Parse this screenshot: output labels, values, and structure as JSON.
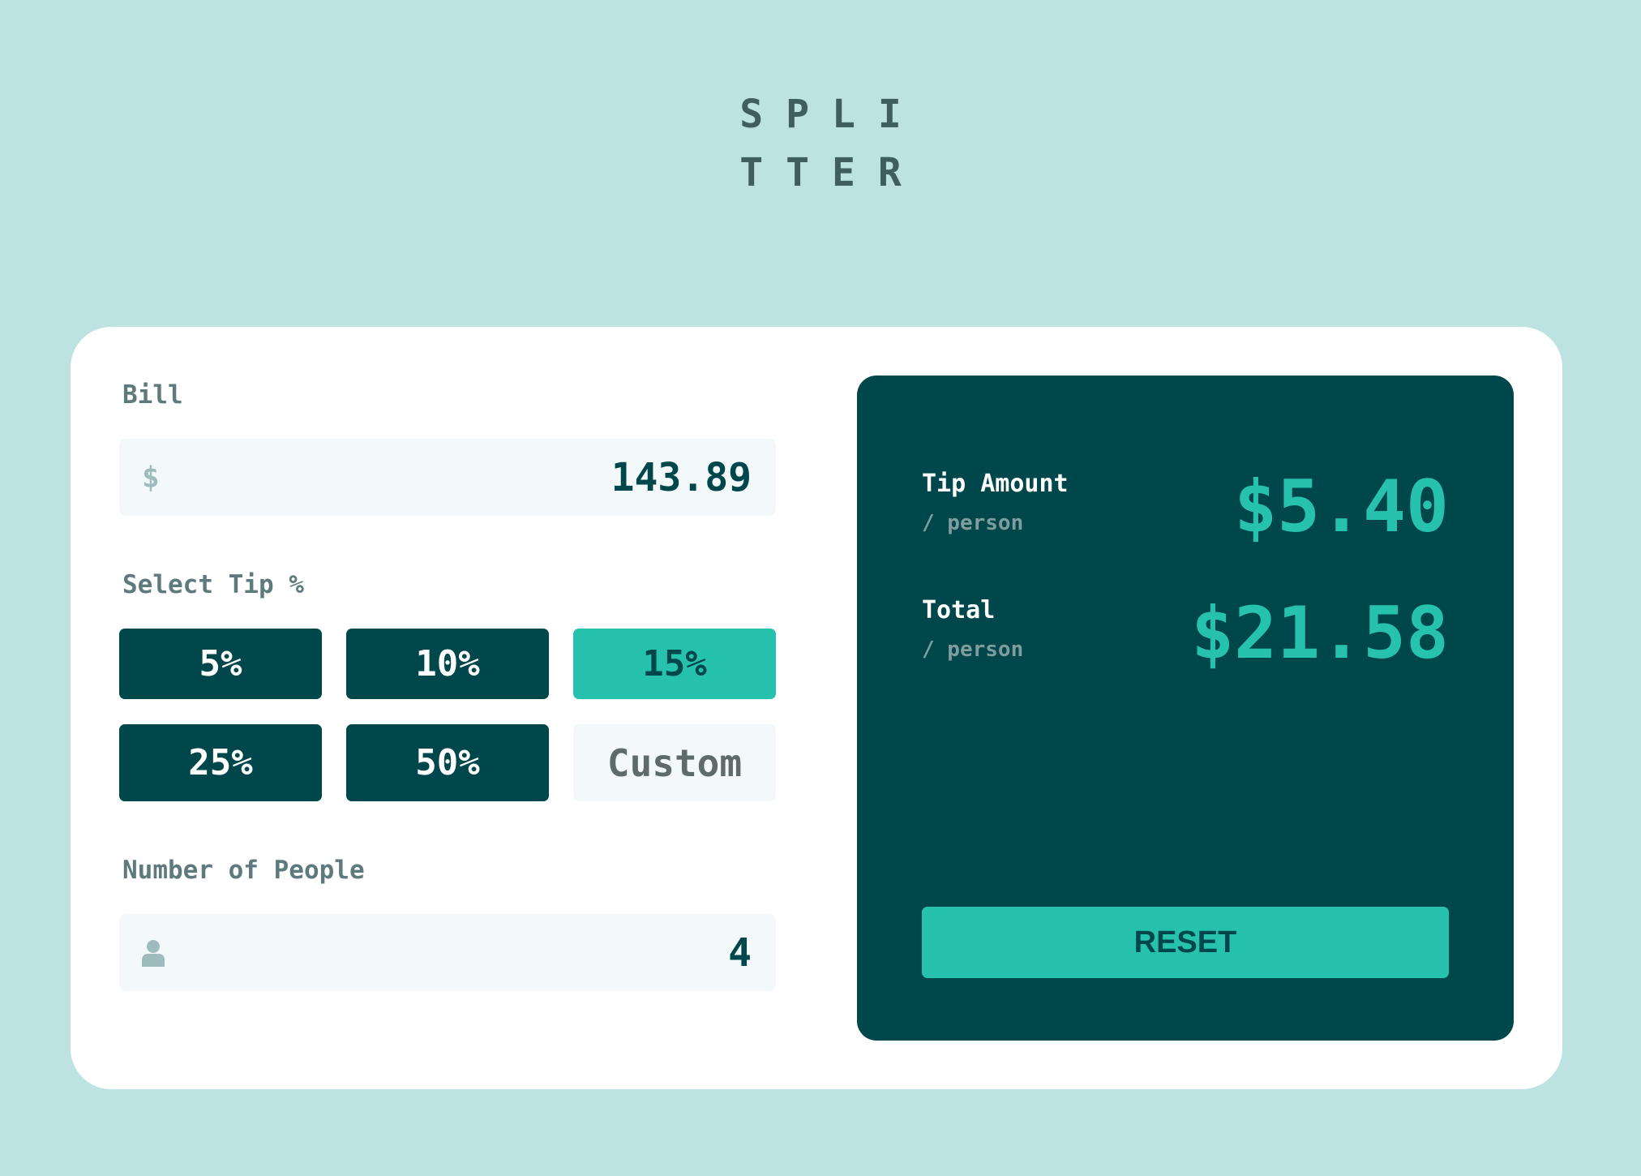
{
  "logo": {
    "line1": "SPLI",
    "line2": "TTER"
  },
  "bill": {
    "label": "Bill",
    "currency_icon": "$",
    "value": "143.89"
  },
  "tip": {
    "label": "Select Tip %",
    "options": [
      "5%",
      "10%",
      "15%",
      "25%",
      "50%"
    ],
    "selected": "15%",
    "custom_placeholder": "Custom"
  },
  "people": {
    "label": "Number of People",
    "icon": "person-icon",
    "value": "4"
  },
  "results": {
    "tip_label": "Tip Amount",
    "tip_sub": "/ person",
    "tip_value": "$5.40",
    "total_label": "Total",
    "total_sub": "/ person",
    "total_value": "$21.58"
  },
  "reset_label": "RESET",
  "colors": {
    "background": "#bce2e2",
    "dark": "#00474b",
    "accent": "#26c2ae",
    "input_bg": "#f3f9fa"
  }
}
